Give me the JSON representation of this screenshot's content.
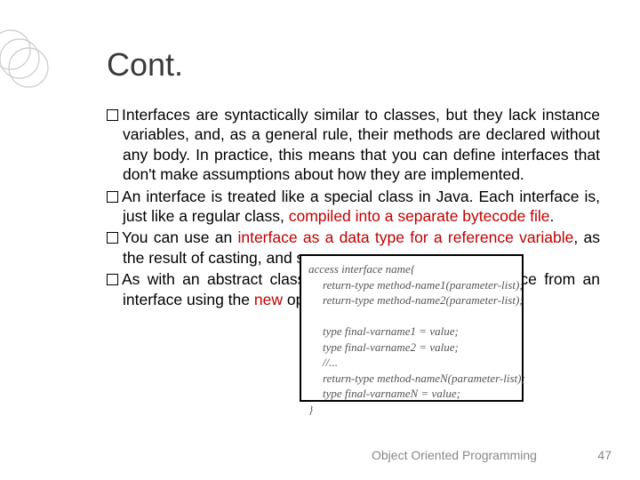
{
  "title": "Cont.",
  "bullets": {
    "b1a": "Interfaces are syntactically similar to classes, but they lack instance variables, and, as a general rule, their methods are declared without any body. In practice, this means that you can define interfaces that don't make assumptions about how they are implemented.",
    "b2a": "An interface is treated like a special class in Java. Each interface is, just like a regular class, ",
    "b2b": "compiled into a separate bytecode file",
    "b2c": ".",
    "b3a": "You can use an ",
    "b3b": "interface as a data type for a reference variable",
    "b3c": ", as the result of casting, and so on.",
    "b4a": "As with an abstract class, you cannot create an instance from an interface using the ",
    "b4b": "new",
    "b4c": " operator."
  },
  "syntax": {
    "l1": "access interface name{",
    "l2": "return-type method-name1(parameter-list);",
    "l3": "return-type method-name2(parameter-list);",
    "l4": "type final-varname1 = value;",
    "l5": "type final-varname2 = value;",
    "l6": "//...",
    "l7": "return-type method-nameN(parameter-list);",
    "l8": "type final-varnameN = value;",
    "l9": "}"
  },
  "footer": {
    "course": "Object Oriented Programming",
    "page": "47"
  }
}
